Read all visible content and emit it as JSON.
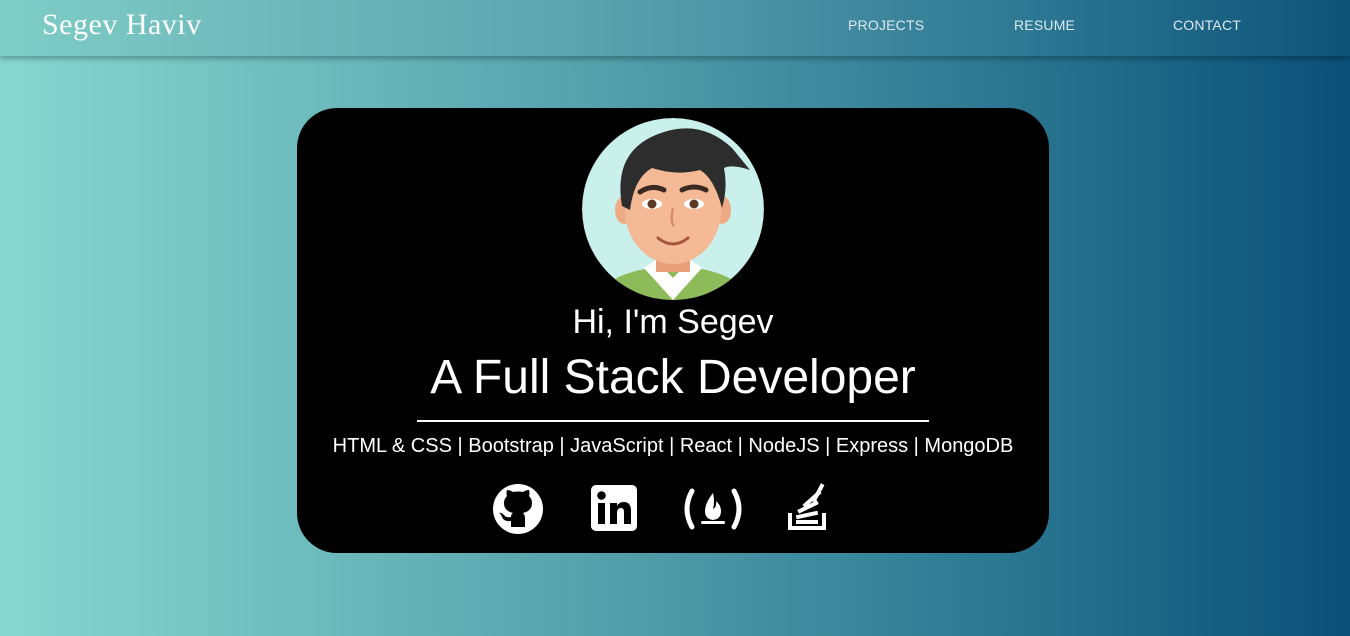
{
  "navbar": {
    "brand": "Segev Haviv",
    "links": [
      {
        "label": "PROJECTS"
      },
      {
        "label": "RESUME"
      },
      {
        "label": "CONTACT"
      }
    ]
  },
  "hero": {
    "greeting": "Hi, I'm Segev",
    "title": "A Full Stack Developer",
    "skills": "HTML & CSS | Bootstrap | JavaScript | React | NodeJS | Express | MongoDB"
  },
  "social_links": [
    {
      "icon": "github-icon"
    },
    {
      "icon": "linkedin-icon"
    },
    {
      "icon": "freecodecamp-icon"
    },
    {
      "icon": "stackoverflow-icon"
    }
  ],
  "colors": {
    "card_background": "#000000",
    "text": "#ffffff",
    "gradient_left": "#86d8cf",
    "gradient_right": "#0a5078"
  }
}
